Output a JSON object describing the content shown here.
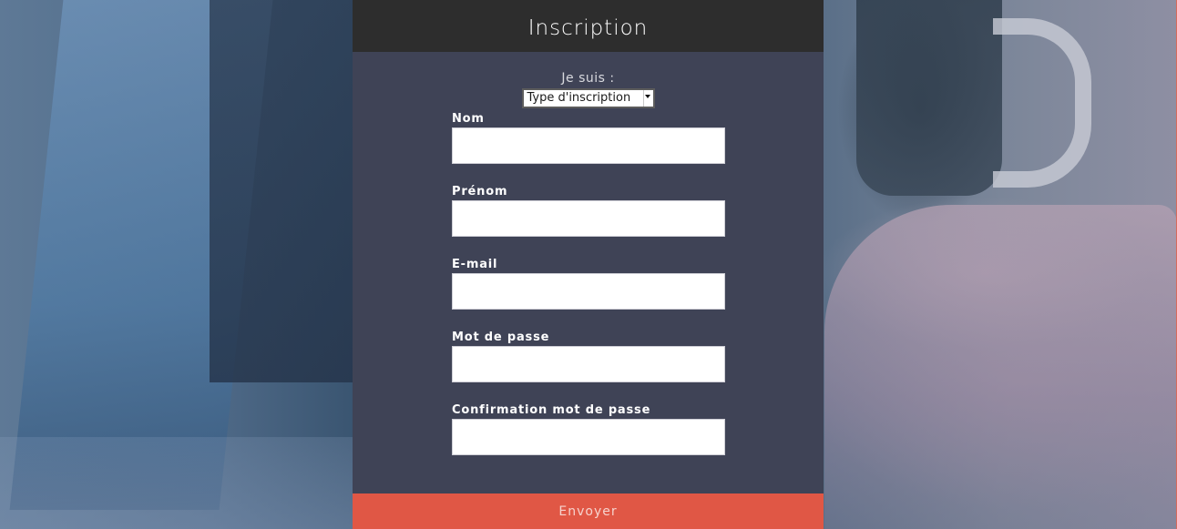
{
  "header": {
    "title": "Inscription"
  },
  "form": {
    "type_label": "Je suis :",
    "type_select_value": "Type d'inscription",
    "fields": [
      {
        "label": "Nom",
        "value": "",
        "placeholder": ""
      },
      {
        "label": "Prénom",
        "value": "",
        "placeholder": ""
      },
      {
        "label": "E-mail",
        "value": "",
        "placeholder": ""
      },
      {
        "label": "Mot de passe",
        "value": "",
        "placeholder": ""
      },
      {
        "label": "Confirmation mot de passe",
        "value": "",
        "placeholder": ""
      }
    ],
    "submit_label": "Envoyer"
  },
  "colors": {
    "header_bg": "#2d2d2d",
    "panel_bg": "#3f4356",
    "submit_bg": "#e05745",
    "submit_text": "#f6d3cd"
  }
}
